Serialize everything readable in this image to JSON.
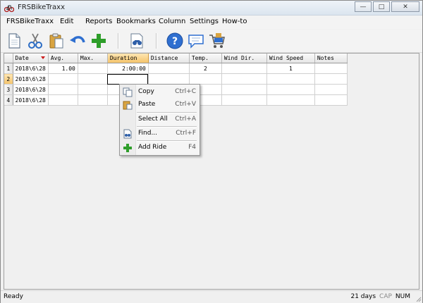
{
  "window": {
    "title": "FRSBikeTraxx",
    "controls": {
      "minimize": "—",
      "maximize": "□",
      "close": "✕"
    }
  },
  "menubar": {
    "items": [
      "FRSBikeTraxx",
      "Edit",
      "Reports",
      "Bookmarks",
      "Column",
      "Settings",
      "How-to"
    ]
  },
  "toolbar": {
    "buttons": [
      {
        "name": "new-document-icon"
      },
      {
        "name": "cut-icon"
      },
      {
        "name": "paste-icon"
      },
      {
        "name": "undo-icon"
      },
      {
        "name": "add-icon"
      },
      {
        "name": "find-icon"
      },
      {
        "name": "help-icon"
      },
      {
        "name": "comment-icon"
      },
      {
        "name": "cart-icon"
      }
    ]
  },
  "grid": {
    "columns": [
      "Date",
      "Avg.",
      "Max.",
      "Duration",
      "Distance",
      "Temp.",
      "Wind Dir.",
      "Wind Speed",
      "Notes"
    ],
    "sorted_column": "Date",
    "active_column": "Duration",
    "active_row": "2",
    "rows": [
      {
        "num": "1",
        "date": "2018\\6\\28",
        "avg": "1.00",
        "max": "",
        "duration": "2:00:00",
        "distance": "",
        "temp": "2",
        "wind_dir": "",
        "wind_speed": "1",
        "notes": ""
      },
      {
        "num": "2",
        "date": "2018\\6\\28",
        "avg": "",
        "max": "",
        "duration": "",
        "distance": "",
        "temp": "",
        "wind_dir": "",
        "wind_speed": "",
        "notes": ""
      },
      {
        "num": "3",
        "date": "2018\\6\\28",
        "avg": "",
        "max": "",
        "duration": "",
        "distance": "",
        "temp": "",
        "wind_dir": "",
        "wind_speed": "",
        "notes": ""
      },
      {
        "num": "4",
        "date": "2018\\6\\28",
        "avg": "",
        "max": "",
        "duration": "",
        "distance": "",
        "temp": "",
        "wind_dir": "",
        "wind_speed": "",
        "notes": ""
      }
    ]
  },
  "context_menu": {
    "items": [
      {
        "label": "Copy",
        "shortcut": "Ctrl+C",
        "icon": "copy-icon"
      },
      {
        "label": "Paste",
        "shortcut": "Ctrl+V",
        "icon": "paste-icon"
      },
      {
        "label": "Select All",
        "shortcut": "Ctrl+A",
        "icon": ""
      },
      {
        "label": "Find...",
        "shortcut": "Ctrl+F",
        "icon": "find-icon"
      },
      {
        "label": "Add Ride",
        "shortcut": "F4",
        "icon": "add-icon"
      }
    ]
  },
  "statusbar": {
    "status": "Ready",
    "days": "21 days",
    "cap": "CAP",
    "num": "NUM"
  },
  "colors": {
    "active_header": "#f4c46b",
    "sort_arrow": "#cc1a1a",
    "add_icon": "#2e9e2a",
    "help_icon": "#2f6fd0"
  }
}
